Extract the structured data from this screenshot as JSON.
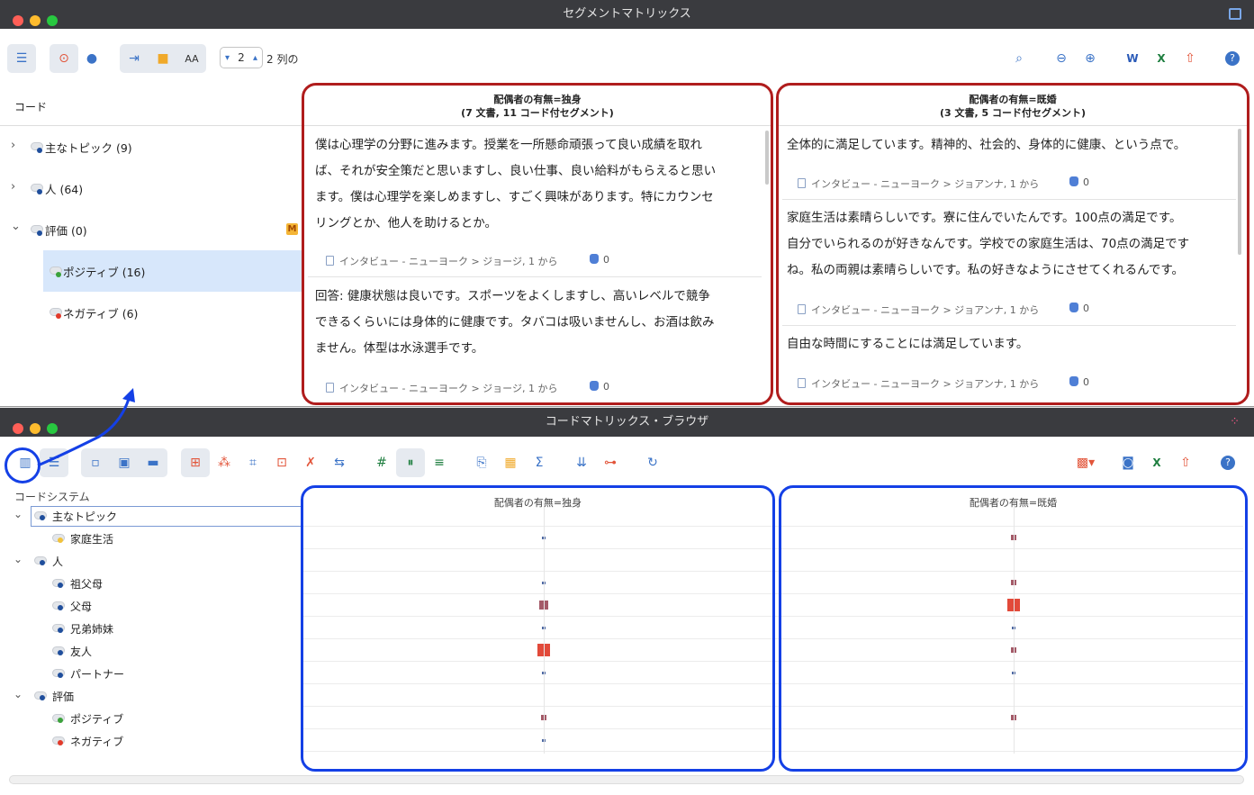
{
  "segment_window": {
    "title": "セグメントマトリックス",
    "toolbar": {
      "columns_value": "2",
      "columns_label": "2 列の",
      "font_size_label": "AA"
    },
    "code_header": "コード",
    "tree": [
      {
        "label": "主なトピック (9)",
        "dot": "#1f4e9c"
      },
      {
        "label": "人 (64)",
        "dot": "#1f4e9c"
      },
      {
        "label": "評価 (0)",
        "dot": "#1f4e9c"
      },
      {
        "label": "ポジティブ (16)",
        "dot": "#3ba23b"
      },
      {
        "label": "ネガティブ (6)",
        "dot": "#e23a2a"
      }
    ],
    "memo_badge": "M",
    "columns": [
      {
        "header_line1": "配偶者の有無=独身",
        "header_line2": "(7 文書, 11 コード付セグメント)",
        "segments": [
          {
            "lines": [
              "僕は心理学の分野に進みます。授業を一所懸命頑張って良い成績を取れ",
              "ば、それが安全策だと思いますし、良い仕事、良い給料がもらえると思い",
              "ます。僕は心理学を楽しめますし、すごく興味があります。特にカウンセ",
              "リングとか、他人を助けるとか。"
            ],
            "source": "インタビュー - ニューヨーク > ジョージ, 1 から",
            "count": "0"
          },
          {
            "lines": [
              "回答: 健康状態は良いです。スポーツをよくしますし、高いレベルで競争",
              "できるくらいには身体的に健康です。タバコは吸いませんし、お酒は飲み",
              "ません。体型は水泳選手です。"
            ],
            "source": "インタビュー - ニューヨーク > ジョージ, 1 から",
            "count": "0"
          }
        ]
      },
      {
        "header_line1": "配偶者の有無=既婚",
        "header_line2": "(3 文書, 5 コード付セグメント)",
        "segments": [
          {
            "lines": [
              "全体的に満足しています。精神的、社会的、身体的に健康、という点で。"
            ],
            "source": "インタビュー - ニューヨーク > ジョアンナ, 1 から",
            "count": "0"
          },
          {
            "lines": [
              "家庭生活は素晴らしいです。寮に住んでいたんです。100点の満足です。",
              "自分でいられるのが好きなんです。学校での家庭生活は、70点の満足です",
              "ね。私の両親は素晴らしいです。私の好きなようにさせてくれるんです。"
            ],
            "source": "インタビュー - ニューヨーク > ジョアンナ, 1 から",
            "count": "0"
          },
          {
            "lines": [
              "自由な時間にすることには満足しています。"
            ],
            "source": "インタビュー - ニューヨーク > ジョアンナ, 1 から",
            "count": "0"
          }
        ]
      }
    ]
  },
  "matrix_window": {
    "title": "コードマトリックス・ブラウザ",
    "code_system_header": "コードシステム",
    "column_headers": [
      "配偶者の有無=独身",
      "配偶者の有無=既婚"
    ],
    "colors": {
      "small": "#4f6aa3",
      "medium": "#a45a68",
      "large": "#e24a3a"
    },
    "rows": [
      {
        "label": "主なトピック",
        "level": 0,
        "dot": "#1f4e9c",
        "cells": [
          0,
          0
        ]
      },
      {
        "label": "家庭生活",
        "level": 1,
        "dot": "#f2c23a",
        "cells": [
          1,
          2
        ]
      },
      {
        "label": "人",
        "level": 0,
        "dot": "#1f4e9c",
        "cells": [
          0,
          0
        ]
      },
      {
        "label": "祖父母",
        "level": 1,
        "dot": "#1f4e9c",
        "cells": [
          1,
          2
        ]
      },
      {
        "label": "父母",
        "level": 1,
        "dot": "#1f4e9c",
        "cells": [
          3,
          4
        ]
      },
      {
        "label": "兄弟姉妹",
        "level": 1,
        "dot": "#1f4e9c",
        "cells": [
          1,
          1
        ]
      },
      {
        "label": "友人",
        "level": 1,
        "dot": "#1f4e9c",
        "cells": [
          4,
          2
        ]
      },
      {
        "label": "パートナー",
        "level": 1,
        "dot": "#1f4e9c",
        "cells": [
          1,
          1
        ]
      },
      {
        "label": "評価",
        "level": 0,
        "dot": "#1f4e9c",
        "cells": [
          0,
          0
        ]
      },
      {
        "label": "ポジティブ",
        "level": 1,
        "dot": "#3ba23b",
        "cells": [
          2,
          2
        ]
      },
      {
        "label": "ネガティブ",
        "level": 1,
        "dot": "#e23a2a",
        "cells": [
          1,
          0
        ]
      }
    ]
  }
}
